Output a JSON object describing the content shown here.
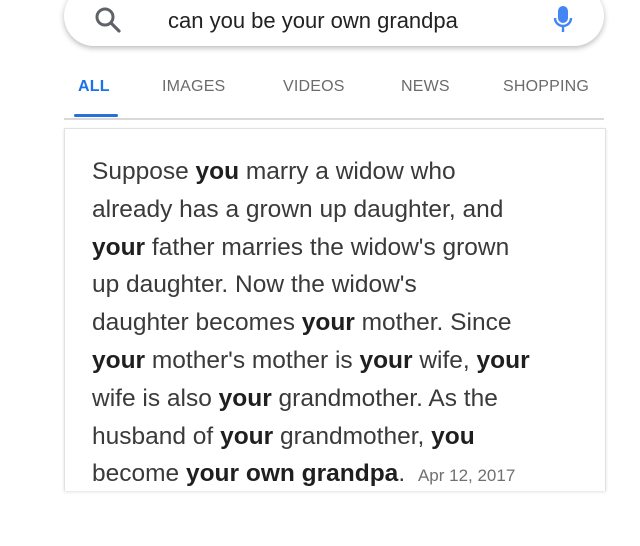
{
  "search": {
    "query": "can you be your own grandpa",
    "icon": "search-icon",
    "mic_icon": "mic-icon",
    "mic_color": "#4285f4"
  },
  "tabs": [
    {
      "label": "ALL",
      "active": true
    },
    {
      "label": "IMAGES",
      "active": false
    },
    {
      "label": "VIDEOS",
      "active": false
    },
    {
      "label": "NEWS",
      "active": false
    },
    {
      "label": "SHOPPING",
      "active": false
    }
  ],
  "colors": {
    "accent": "#1a73e8",
    "text": "#3a3a3a",
    "muted": "#707070"
  },
  "snippet": {
    "lines": [
      [
        {
          "t": "Suppose "
        },
        {
          "t": "you",
          "b": true
        },
        {
          "t": " marry a widow who"
        }
      ],
      [
        {
          "t": "already has a grown up daughter, and"
        }
      ],
      [
        {
          "t": "your",
          "b": true
        },
        {
          "t": " father marries the widow's grown"
        }
      ],
      [
        {
          "t": "up daughter. Now the widow's"
        }
      ],
      [
        {
          "t": "daughter becomes "
        },
        {
          "t": "your",
          "b": true
        },
        {
          "t": " mother. Since"
        }
      ],
      [
        {
          "t": "your",
          "b": true
        },
        {
          "t": " mother's mother is "
        },
        {
          "t": "your",
          "b": true
        },
        {
          "t": " wife, "
        },
        {
          "t": "your",
          "b": true
        }
      ],
      [
        {
          "t": "wife is also "
        },
        {
          "t": "your",
          "b": true
        },
        {
          "t": " grandmother. As the"
        }
      ],
      [
        {
          "t": "husband of "
        },
        {
          "t": "your",
          "b": true
        },
        {
          "t": " grandmother, "
        },
        {
          "t": "you",
          "b": true
        }
      ],
      [
        {
          "t": "become "
        },
        {
          "t": "your own grandpa",
          "b": true
        },
        {
          "t": ". "
        }
      ]
    ],
    "date": "Apr 12, 2017"
  }
}
